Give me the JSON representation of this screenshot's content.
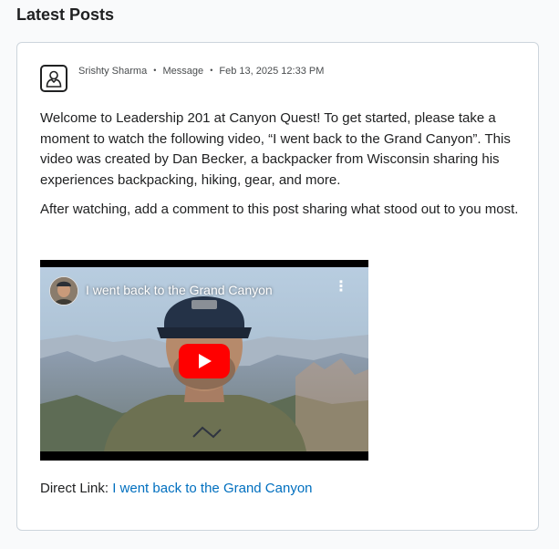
{
  "section": {
    "title": "Latest Posts"
  },
  "post": {
    "author": "Srishty Sharma",
    "type": "Message",
    "date": "Feb 13, 2025 12:33 PM",
    "separator": "•",
    "paragraphs": [
      "Welcome to Leadership 201 at Canyon Quest! To get started, please take a moment to watch the following video, “I went back to the Grand Canyon”. This video was created by Dan Becker, a backpacker from Wisconsin sharing his experiences backpacking, hiking, gear, and more.",
      "After watching, add a comment to this post sharing what stood out to you most."
    ],
    "video": {
      "title": "I went back to the Grand Canyon",
      "menu_glyph": "⋮",
      "play_color": "#ff0000"
    },
    "direct_link": {
      "label": "Direct Link:",
      "text": "I went back to the Grand Canyon"
    }
  },
  "colors": {
    "link": "#006fbf",
    "border": "#cdd5dc"
  },
  "icons": {
    "avatar": "user-icon",
    "play": "play-icon",
    "menu": "more-vertical-icon"
  }
}
